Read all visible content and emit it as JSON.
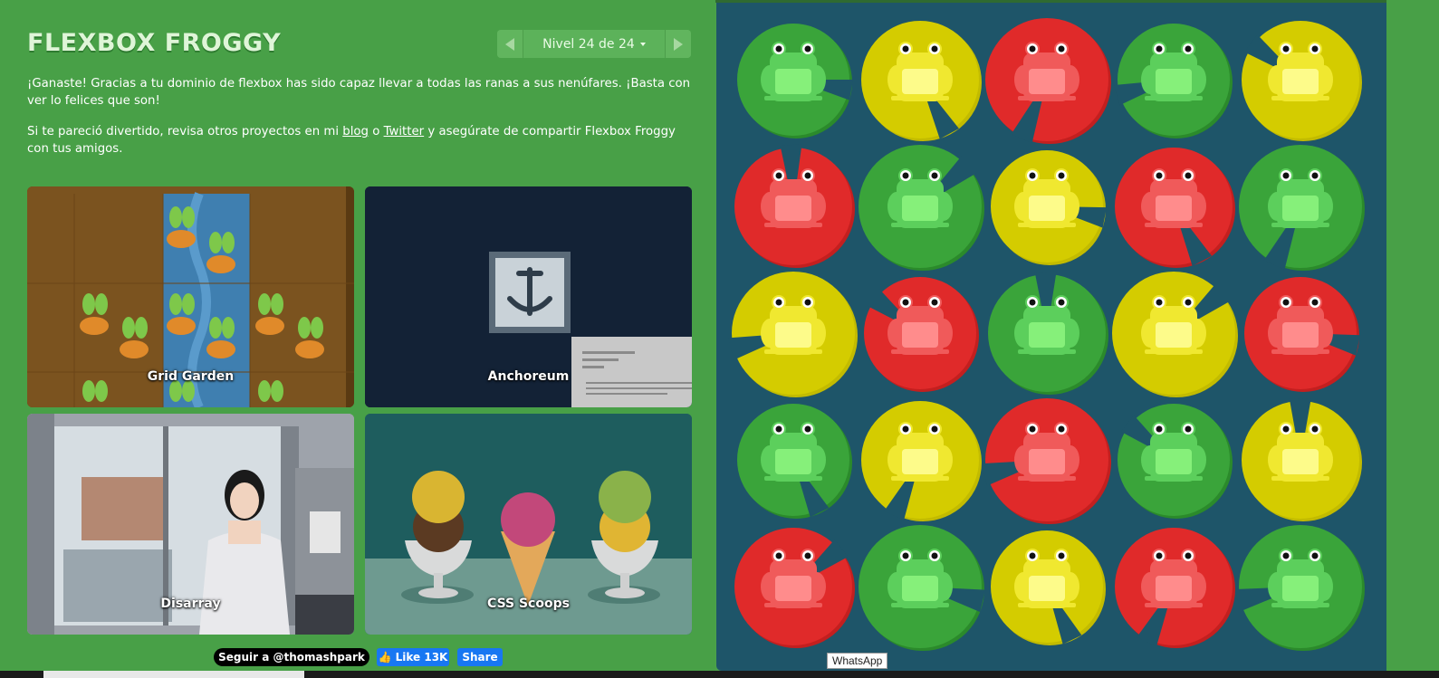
{
  "header": {
    "logo": "FLEXBOX FROGGY",
    "level_label": "Nivel 24 de 24"
  },
  "messages": {
    "win": "¡Ganaste! Gracias a tu dominio de flexbox has sido capaz llevar a todas las ranas a sus nenúfares. ¡Basta con ver lo felices que son!",
    "more_prefix": "Si te pareció divertido, revisa otros proyectos en mi ",
    "blog_link": "blog",
    "or_text": " o ",
    "twitter_link": "Twitter",
    "more_suffix": " y asegúrate de compartir Flexbox Froggy con tus amigos."
  },
  "projects": [
    {
      "name": "Grid Garden"
    },
    {
      "name": "Anchoreum"
    },
    {
      "name": "Disarray"
    },
    {
      "name": "CSS Scoops"
    }
  ],
  "social": {
    "twitter_follow": "Seguir a @thomashpark",
    "fb_like": "Like 13K",
    "fb_share": "Share"
  },
  "board": {
    "rows": [
      [
        "green",
        "yellow",
        "red",
        "green",
        "yellow"
      ],
      [
        "red",
        "green",
        "yellow",
        "red",
        "green"
      ],
      [
        "yellow",
        "red",
        "green",
        "yellow",
        "red"
      ],
      [
        "green",
        "yellow",
        "red",
        "green",
        "yellow"
      ],
      [
        "red",
        "green",
        "yellow",
        "red",
        "green"
      ]
    ]
  },
  "colors": {
    "green": "#3aa43a",
    "yellow": "#d4cc00",
    "red": "#e02a2a",
    "board": "#1e5569"
  },
  "tooltip": "WhatsApp"
}
